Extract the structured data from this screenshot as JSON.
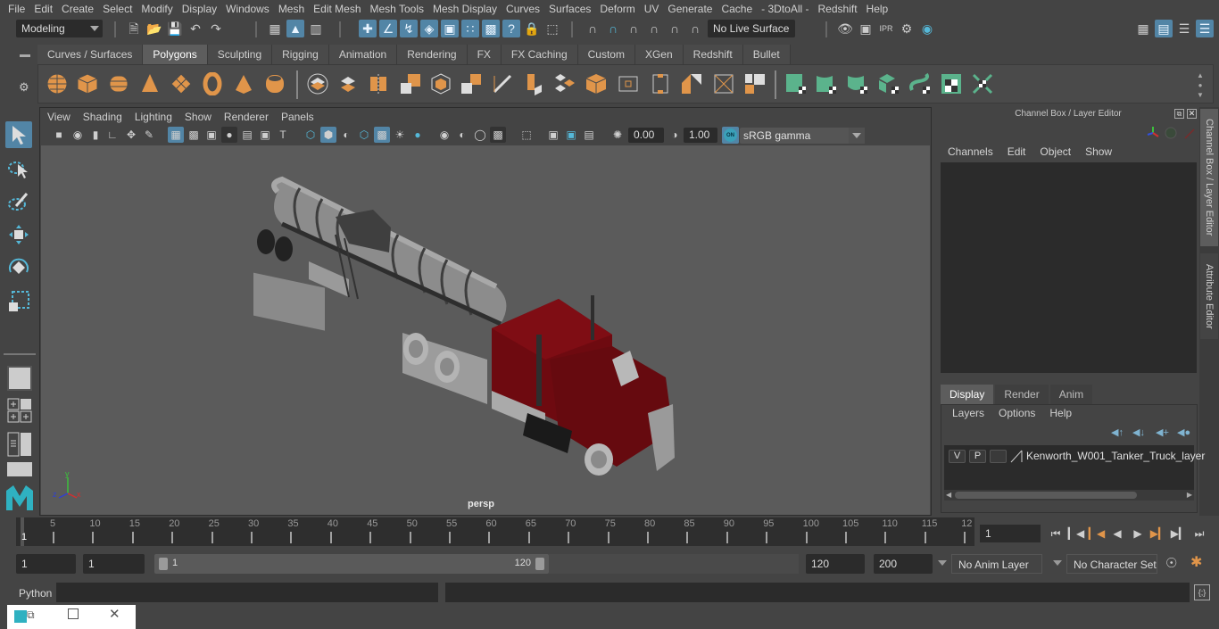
{
  "menubar": [
    "File",
    "Edit",
    "Create",
    "Select",
    "Modify",
    "Display",
    "Windows",
    "Mesh",
    "Edit Mesh",
    "Mesh Tools",
    "Mesh Display",
    "Curves",
    "Surfaces",
    "Deform",
    "UV",
    "Generate",
    "Cache",
    "- 3DtoAll -",
    "Redshift",
    "Help"
  ],
  "statusline": {
    "mode": "Modeling",
    "live_surface": "No Live Surface"
  },
  "shelf": {
    "tabs": [
      "Curves / Surfaces",
      "Polygons",
      "Sculpting",
      "Rigging",
      "Animation",
      "Rendering",
      "FX",
      "FX Caching",
      "Custom",
      "XGen",
      "Redshift",
      "Bullet"
    ],
    "active_tab": "Polygons"
  },
  "viewport": {
    "menu": [
      "View",
      "Shading",
      "Lighting",
      "Show",
      "Renderer",
      "Panels"
    ],
    "exposure": "0.00",
    "gamma": "1.00",
    "color_mgmt_toggle": "ON",
    "color_space": "sRGB gamma",
    "camera": "persp",
    "axis": {
      "x": "x",
      "y": "y",
      "z": "z"
    }
  },
  "channel_box": {
    "title": "Channel Box / Layer Editor",
    "menu": [
      "Channels",
      "Edit",
      "Object",
      "Show"
    ]
  },
  "side_tabs": [
    "Channel Box / Layer Editor",
    "Attribute Editor"
  ],
  "layer_editor": {
    "tabs": [
      "Display",
      "Render",
      "Anim"
    ],
    "active_tab": "Display",
    "menu": [
      "Layers",
      "Options",
      "Help"
    ],
    "layers": [
      {
        "visible": "V",
        "playback": "P",
        "name": "Kenworth_W001_Tanker_Truck_layer"
      }
    ]
  },
  "timeline": {
    "ticks": [
      "5",
      "10",
      "15",
      "20",
      "25",
      "30",
      "35",
      "40",
      "45",
      "50",
      "55",
      "60",
      "65",
      "70",
      "75",
      "80",
      "85",
      "90",
      "95",
      "100",
      "105",
      "110",
      "115",
      "12"
    ],
    "current_marker": "1",
    "current_frame": "1"
  },
  "range": {
    "start_time": "1",
    "playback_start": "1",
    "slider_start": "1",
    "slider_end": "120",
    "playback_end": "120",
    "end_time": "200",
    "anim_layer": "No Anim Layer",
    "character_set": "No Character Set"
  },
  "command_line": {
    "language": "Python",
    "input": "",
    "output": ""
  },
  "colors": {
    "accent_blue": "#5285a6",
    "shelf_orange": "#e0954a",
    "shelf_green": "#5bb38c",
    "truck_red": "#7a0a10",
    "viewport_bg": "#5b5b5b"
  }
}
